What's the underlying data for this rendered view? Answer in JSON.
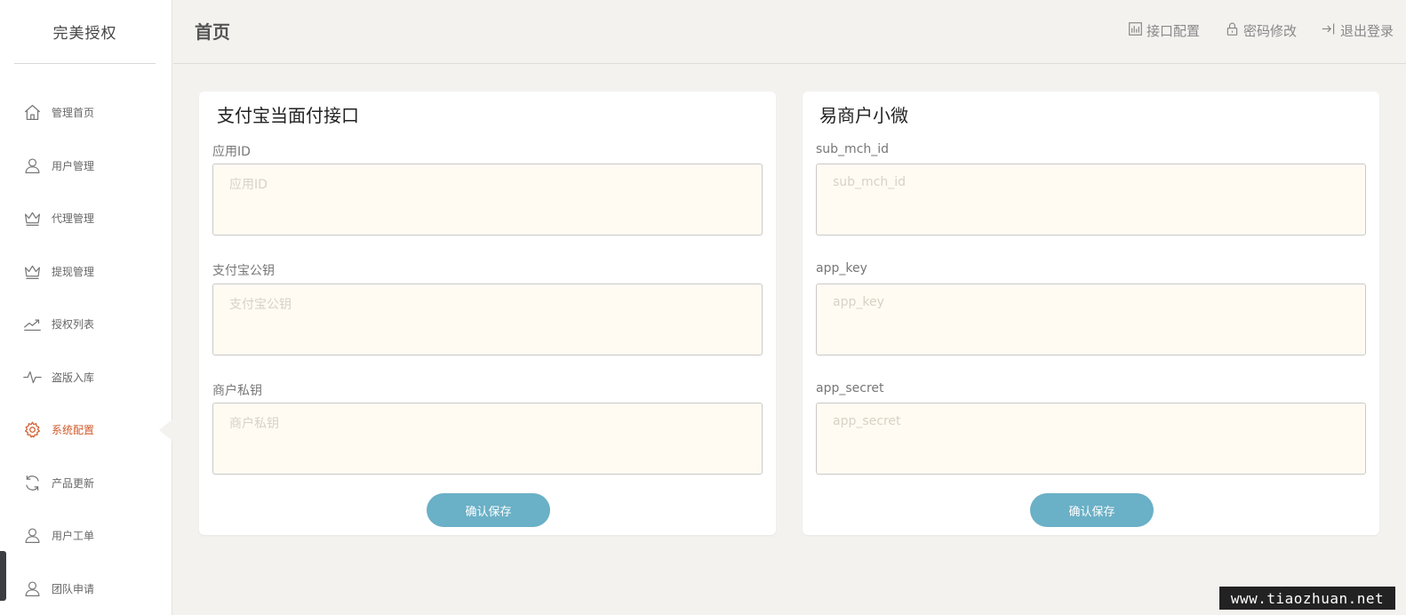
{
  "brand": "完美授权",
  "sidebar": {
    "items": [
      {
        "label": "管理首页",
        "icon": "home-icon",
        "active": false
      },
      {
        "label": "用户管理",
        "icon": "user-icon",
        "active": false
      },
      {
        "label": "代理管理",
        "icon": "crown-icon",
        "active": false
      },
      {
        "label": "提现管理",
        "icon": "crown-icon",
        "active": false
      },
      {
        "label": "授权列表",
        "icon": "trend-icon",
        "active": false
      },
      {
        "label": "盗版入库",
        "icon": "pulse-icon",
        "active": false
      },
      {
        "label": "系统配置",
        "icon": "gear-icon",
        "active": true
      },
      {
        "label": "产品更新",
        "icon": "refresh-icon",
        "active": false
      },
      {
        "label": "用户工单",
        "icon": "user-icon",
        "active": false
      },
      {
        "label": "团队申请",
        "icon": "user-icon",
        "active": false
      }
    ]
  },
  "header": {
    "title": "首页",
    "actions": [
      {
        "label": "接口配置",
        "icon": "chart-box-icon"
      },
      {
        "label": "密码修改",
        "icon": "lock-icon"
      },
      {
        "label": "退出登录",
        "icon": "logout-icon"
      }
    ]
  },
  "alipay_card": {
    "title": "支付宝当面付接口",
    "fields": [
      {
        "label": "应用ID",
        "placeholder": "应用ID",
        "value": ""
      },
      {
        "label": "支付宝公钥",
        "placeholder": "支付宝公钥",
        "value": ""
      },
      {
        "label": "商户私钥",
        "placeholder": "商户私钥",
        "value": ""
      }
    ],
    "save_label": "确认保存"
  },
  "yishang_card": {
    "title": "易商户小微",
    "fields": [
      {
        "label": "sub_mch_id",
        "placeholder": "sub_mch_id",
        "value": ""
      },
      {
        "label": "app_key",
        "placeholder": "app_key",
        "value": ""
      },
      {
        "label": "app_secret",
        "placeholder": "app_secret",
        "value": ""
      }
    ],
    "save_label": "确认保存"
  },
  "watermark": "www.tiaozhuan.net",
  "colors": {
    "accent": "#d05a2a",
    "button": "#6ab0c6",
    "input_bg": "#fffbf2",
    "page_bg": "#f3f2ef"
  }
}
